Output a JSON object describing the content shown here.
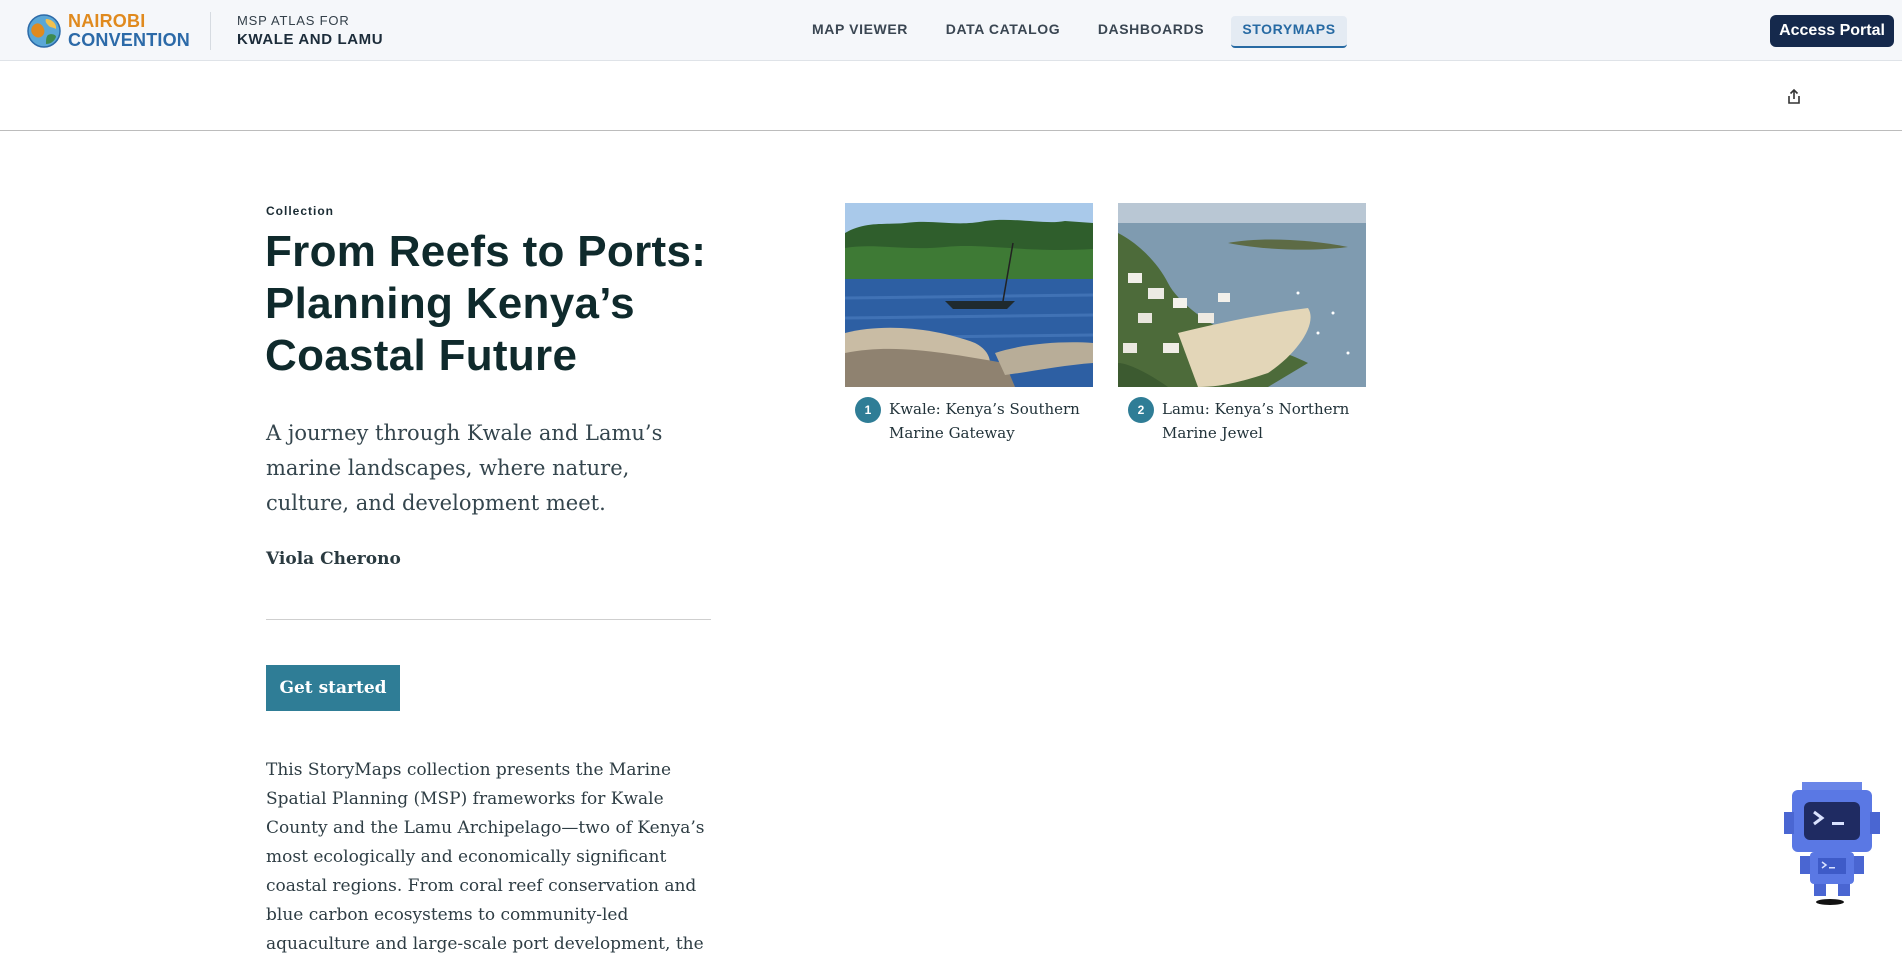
{
  "header": {
    "logo_line1": "NAIROBI",
    "logo_line2": "CONVENTION",
    "atlas_line1": "MSP ATLAS FOR",
    "atlas_line2": "KWALE AND LAMU",
    "nav": [
      {
        "label": "MAP VIEWER",
        "active": false
      },
      {
        "label": "DATA CATALOG",
        "active": false
      },
      {
        "label": "DASHBOARDS",
        "active": false
      },
      {
        "label": "STORYMAPS",
        "active": true
      }
    ],
    "portal_label": "Access Portal"
  },
  "subbar": {
    "share_icon": "share-icon"
  },
  "collection": {
    "kicker": "Collection",
    "title": "From Reefs to Ports: Planning Kenya’s Coastal Future",
    "subtitle": "A journey through Kwale and Lamu’s marine landscapes, where nature, culture, and development meet.",
    "author": "Viola Cherono",
    "start_label": "Get started",
    "description": "This StoryMaps collection presents the Marine Spatial Planning (MSP) frameworks for Kwale County and the Lamu Archipelago—two of Kenya’s most ecologically and economically significant coastal regions. From coral reef conservation and blue carbon ecosystems to community-led aquaculture and large-scale port development, the"
  },
  "items": [
    {
      "number": "1",
      "title": "Kwale: Kenya’s Southern Marine Gateway"
    },
    {
      "number": "2",
      "title": "Lamu: Kenya’s Northern Marine Jewel"
    }
  ],
  "colors": {
    "accent": "#2f7d96",
    "nav_active": "#276aa3",
    "portal": "#15294c",
    "logo_orange": "#e08a1e",
    "logo_blue": "#2c6aa8"
  }
}
